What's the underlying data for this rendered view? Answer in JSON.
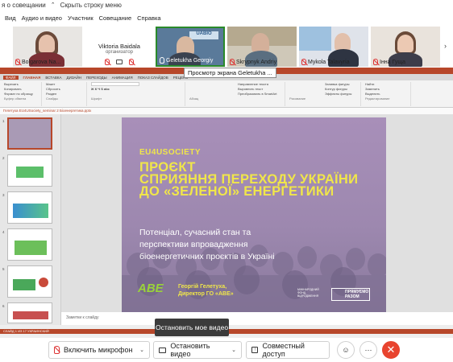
{
  "menubar": {
    "items": [
      "я о совещании",
      "Скрыть строку меню"
    ]
  },
  "menu": {
    "items": [
      "Вид",
      "Аудио и видео",
      "Участник",
      "Совещание",
      "Справка"
    ]
  },
  "participants": [
    {
      "name": "Bolgarova Na...",
      "role": ""
    },
    {
      "name": "Viktoria Baidala",
      "role": "организатор"
    },
    {
      "name": "Geletukha Georgiy",
      "role": ""
    },
    {
      "name": "Skrypnyk Andriy",
      "role": ""
    },
    {
      "name": "Mykola Talavyria",
      "role": ""
    },
    {
      "name": "Інна Гуща",
      "role": ""
    }
  ],
  "share": {
    "screen_label": "Просмотр экрана Geletukha ...",
    "ppt_tabs": [
      "ФАЙЛ",
      "ГЛАВНАЯ",
      "ВСТАВКА",
      "ДИЗАЙН",
      "ПЕРЕХОДЫ",
      "АНИМАЦИЯ",
      "ПОКАЗ СЛАЙДОВ",
      "РЕЦЕНЗ"
    ],
    "ribbon": {
      "clipboard": [
        "Вырезать",
        "Копировать",
        "Формат по образцу"
      ],
      "clipboard_group": "Буфер обмена",
      "slides": [
        "Создать слайд",
        "Макет",
        "Сбросить",
        "Раздел"
      ],
      "slides_group": "Слайды",
      "font_group": "Шрифт",
      "paragraph_items": [
        "Направление текста",
        "Выровнять текст",
        "Преобразовать в SmartArt"
      ],
      "paragraph_group": "Абзац",
      "drawing_items": [
        "Упорядочить",
        "Экспресс-стили",
        "Заливка фигуры",
        "Контур фигуры",
        "Эффекты фигуры"
      ],
      "drawing_group": "Рисование",
      "editing_items": [
        "Найти",
        "Заменить",
        "Выделить"
      ],
      "editing_group": "Редактирование"
    },
    "file_name": "Гелетуха EU4USociety_seminar 2 Біоенергетика.pptx",
    "notes_label": "Заметки к слайду",
    "slide_numbers": [
      "1",
      "2",
      "3",
      "4",
      "5",
      "6"
    ],
    "statusbar": "СЛАЙД 1 ИЗ 17   УКРАИНСКИЙ",
    "slide": {
      "brand": "EU4USOCIETY",
      "title": "ПРОЄКТ\nСПРИЯННЯ ПЕРЕХОДУ УКРАЇНИ\nДО «ЗЕЛЕНОЇ» ЕНЕРГЕТИКИ",
      "subtitle": "Потенціал, сучасний стан та\nперспективи впровадження\nбіоенергетичних проєктів в Україні",
      "logo": "ABE",
      "author": "Георгій Гелетуха,\nДиректор ГО «АВЕ»",
      "partner": "МІЖНАРОДНИЙ\nФОНД\nВІДРОДЖЕННЯ",
      "partner2": "ПРЯМУЄМО\nРАЗОМ"
    }
  },
  "tooltip": "Остановить мое видео",
  "toolbar": {
    "mic_label": "Включить микрофон",
    "video_label": "Остановить видео",
    "share_label": "Совместный доступ"
  },
  "colors": {
    "ppt_accent": "#b7472a",
    "end_call": "#e8442f",
    "slide_yellow": "#f0e64a",
    "slide_purple": "#a88fb9"
  }
}
